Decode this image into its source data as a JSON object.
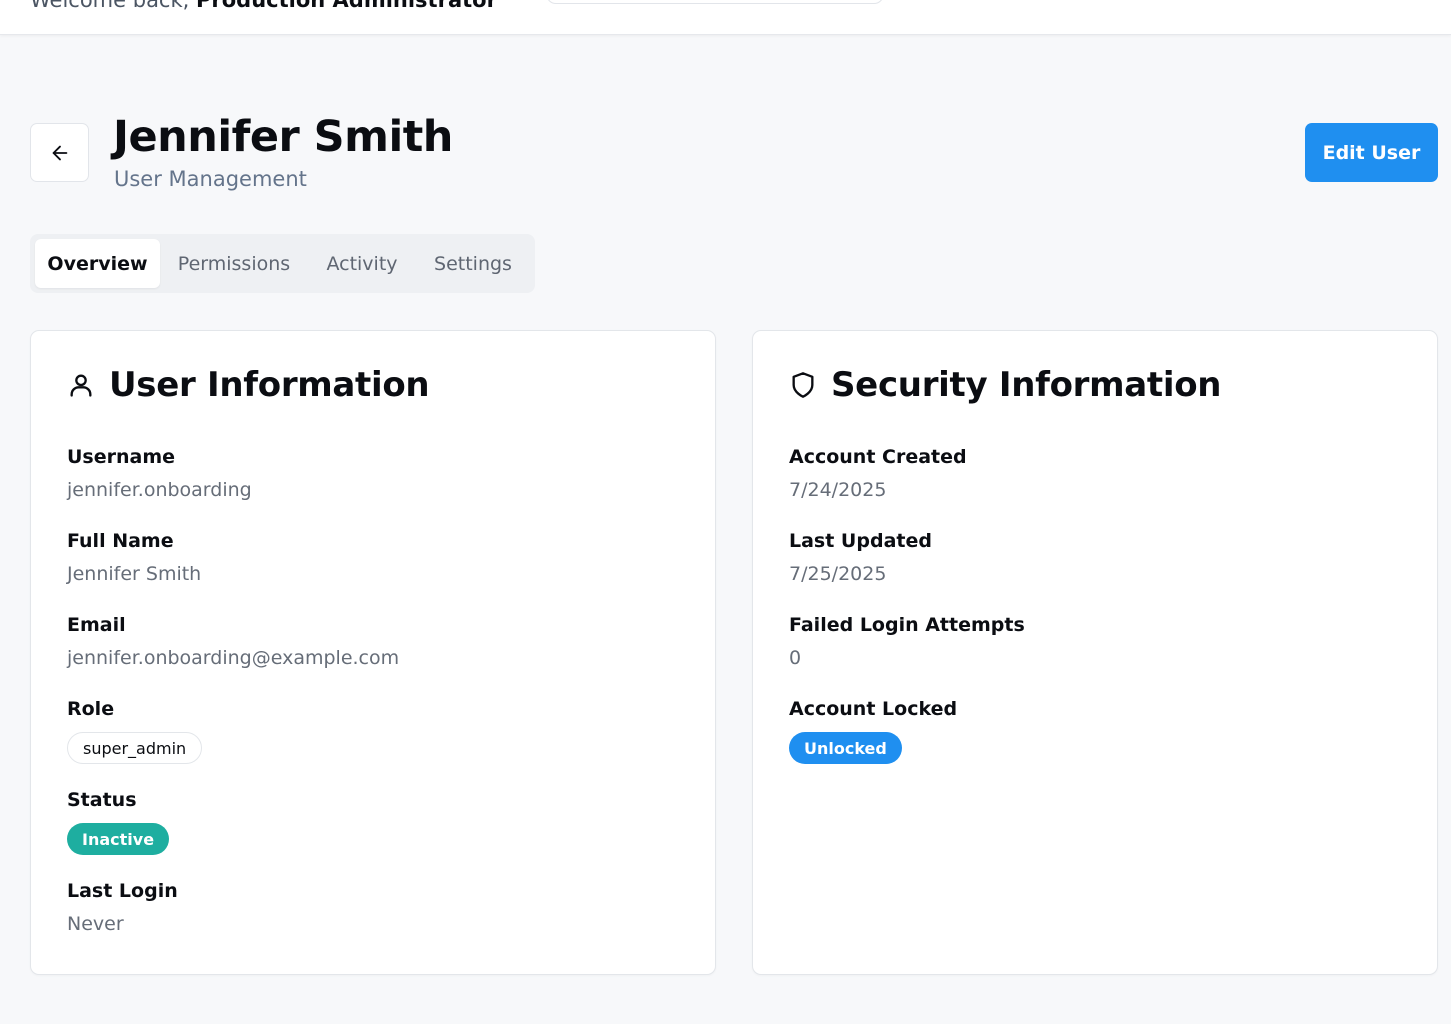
{
  "topbar": {
    "welcome_prefix": "Welcome back, ",
    "welcome_name": "Production Administrator"
  },
  "header": {
    "title": "Jennifer Smith",
    "subtitle": "User Management",
    "edit_label": "Edit User"
  },
  "tabs": [
    {
      "label": "Overview",
      "active": true
    },
    {
      "label": "Permissions",
      "active": false
    },
    {
      "label": "Activity",
      "active": false
    },
    {
      "label": "Settings",
      "active": false
    }
  ],
  "user_info": {
    "title": "User Information",
    "username_label": "Username",
    "username": "jennifer.onboarding",
    "fullname_label": "Full Name",
    "fullname": "Jennifer Smith",
    "email_label": "Email",
    "email": "jennifer.onboarding@example.com",
    "role_label": "Role",
    "role": "super_admin",
    "status_label": "Status",
    "status": "Inactive",
    "last_login_label": "Last Login",
    "last_login": "Never"
  },
  "security_info": {
    "title": "Security Information",
    "created_label": "Account Created",
    "created": "7/24/2025",
    "updated_label": "Last Updated",
    "updated": "7/25/2025",
    "failed_label": "Failed Login Attempts",
    "failed": "0",
    "locked_label": "Account Locked",
    "locked": "Unlocked"
  },
  "colors": {
    "primary": "#1f8ff0",
    "status_teal": "#1eaea0",
    "background": "#f7f8fa"
  },
  "icons": {
    "back": "arrow-left-icon",
    "user": "user-icon",
    "security": "shield-icon"
  }
}
